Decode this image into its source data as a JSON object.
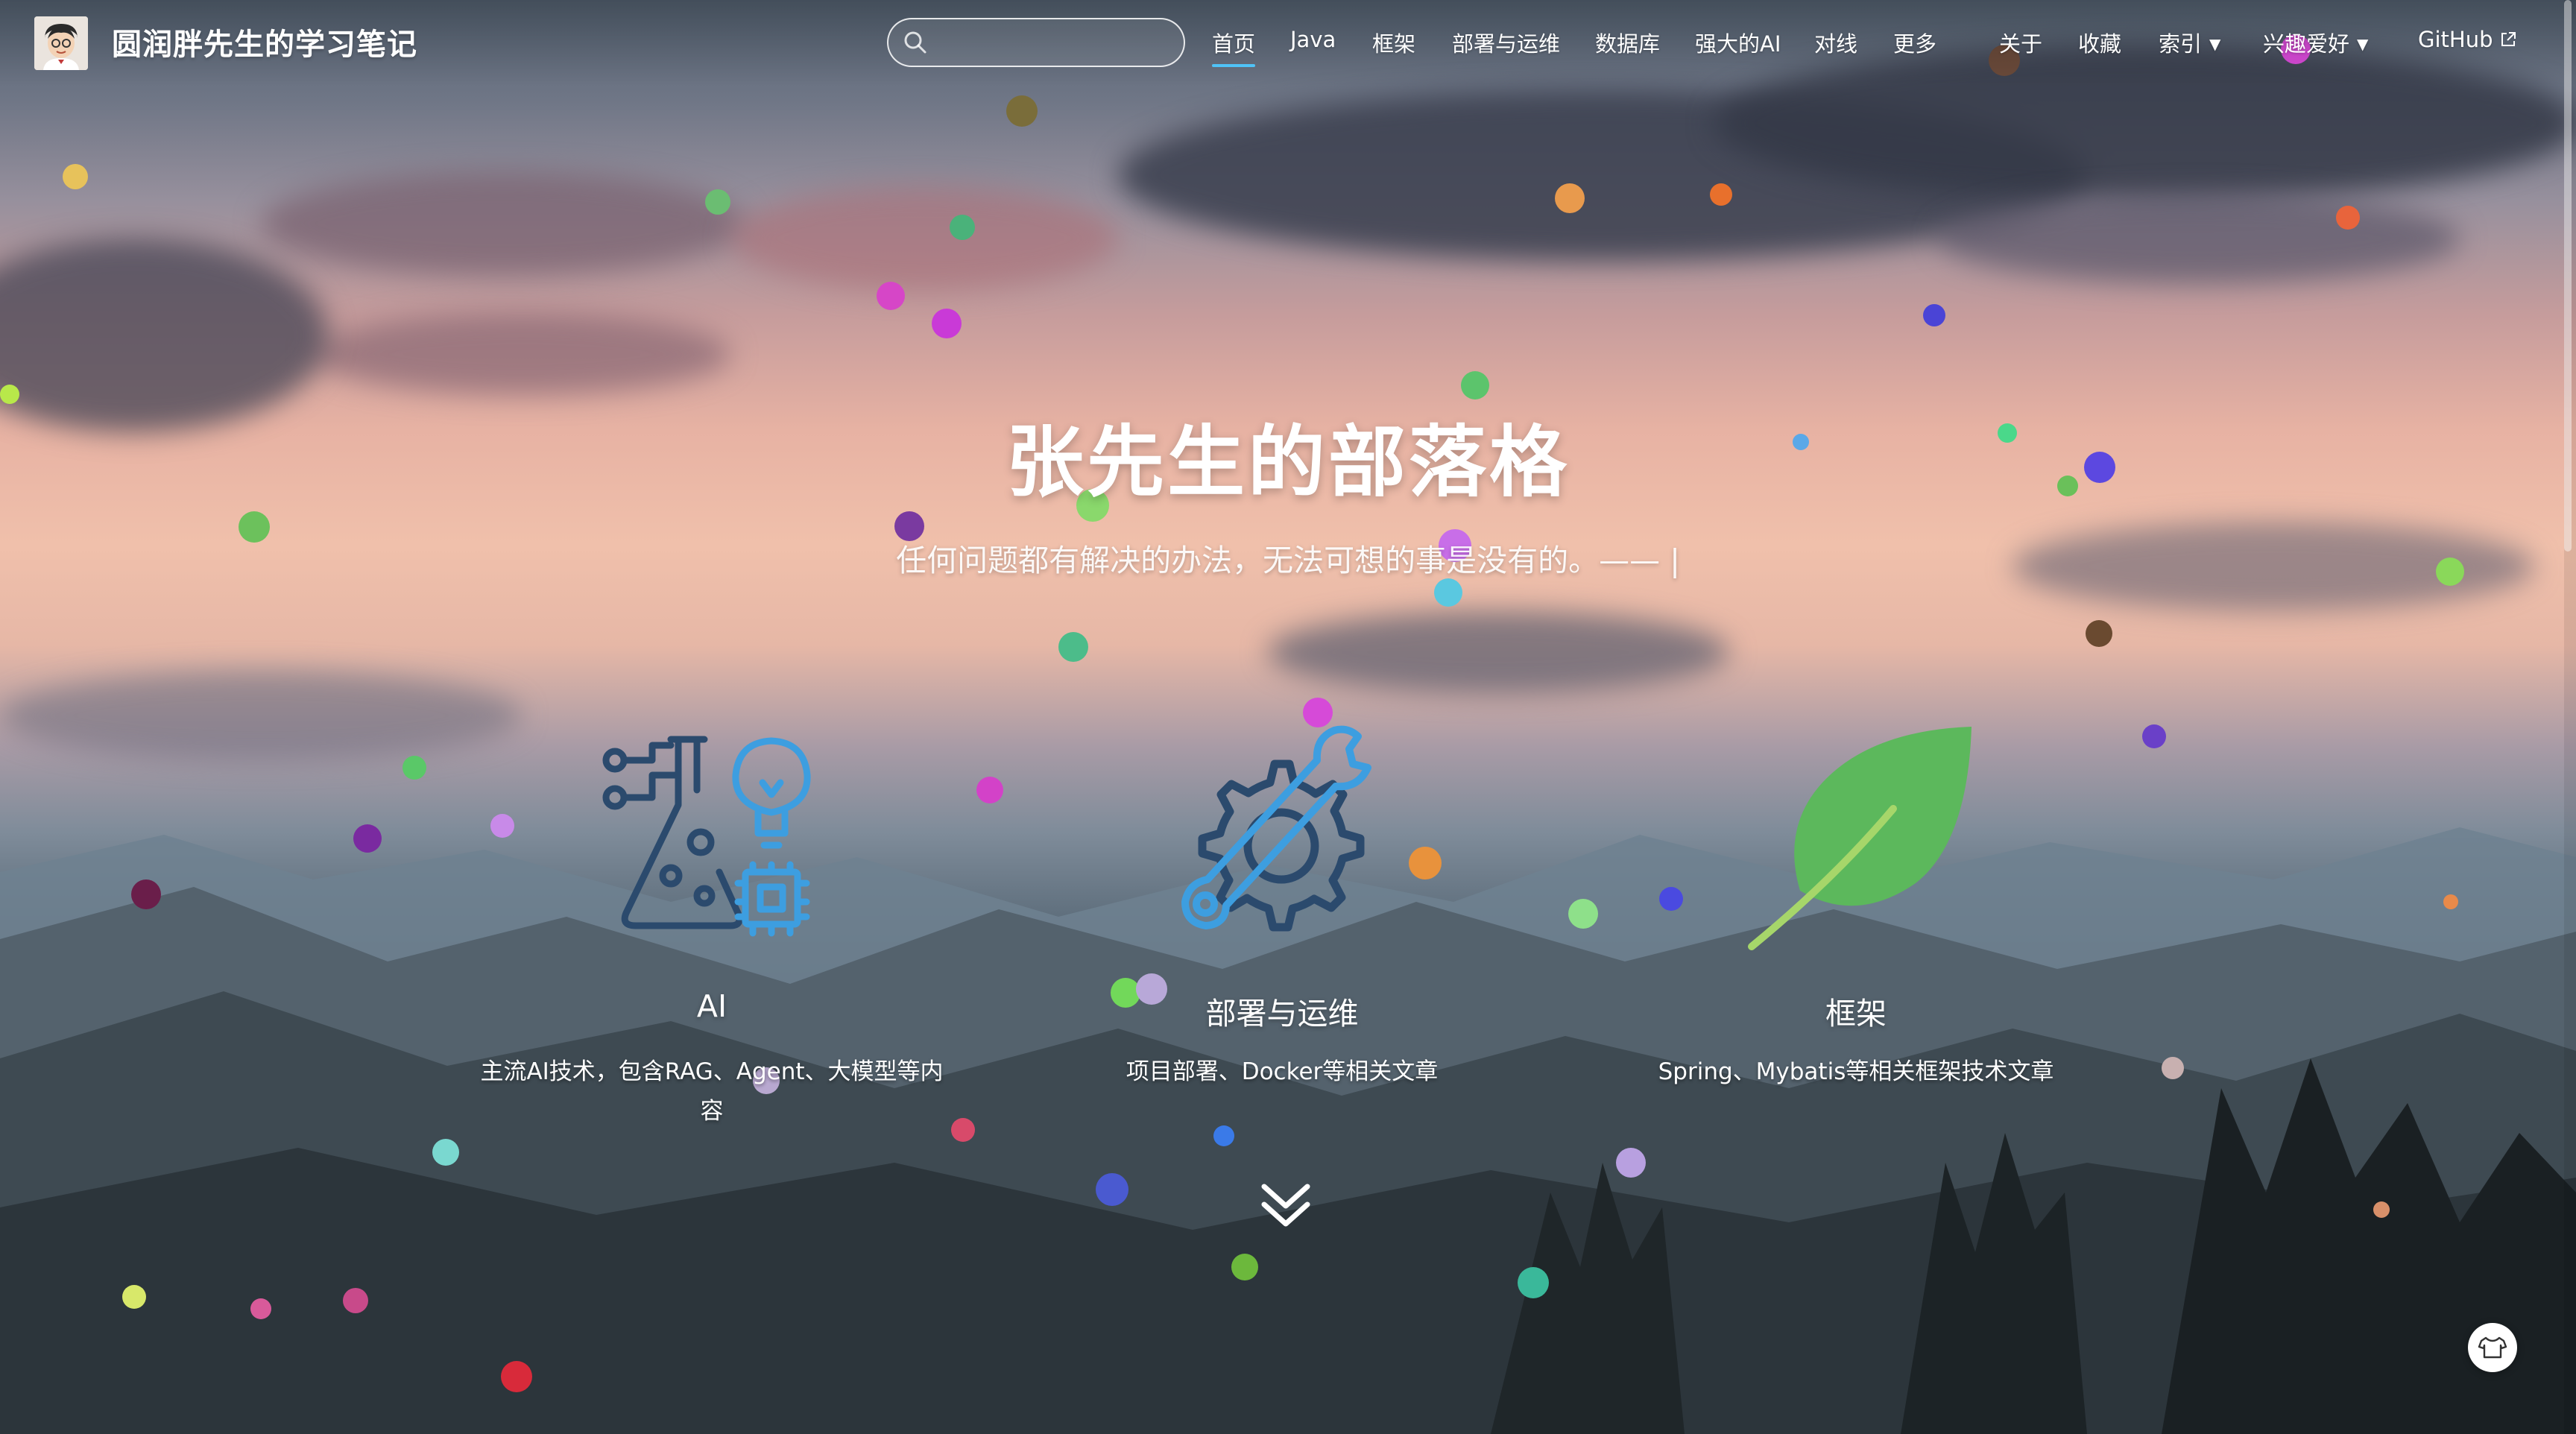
{
  "navbar": {
    "site_title": "圆润胖先生的学习笔记",
    "search_placeholder": "",
    "items": [
      {
        "label": "首页",
        "active": true
      },
      {
        "label": "Java"
      },
      {
        "label": "框架"
      },
      {
        "label": "部署与运维"
      },
      {
        "label": "数据库"
      },
      {
        "label": "强大的AI"
      },
      {
        "label": "对线"
      },
      {
        "label": "更多"
      },
      {
        "label": "关于"
      },
      {
        "label": "收藏"
      },
      {
        "label": "索引",
        "dropdown": true
      },
      {
        "label": "兴趣爱好",
        "dropdown": true
      },
      {
        "label": "GitHub",
        "external": true
      }
    ]
  },
  "hero": {
    "title": "张先生的部落格",
    "subtitle": "任何问题都有解决的办法，无法可想的事是没有的。—— |"
  },
  "features": [
    {
      "icon": "ai-lab-icon",
      "title": "AI",
      "description": "主流AI技术，包含RAG、Agent、大模型等内容"
    },
    {
      "icon": "gear-wrench-icon",
      "title": "部署与运维",
      "description": "项目部署、Docker等相关文章"
    },
    {
      "icon": "leaf-icon",
      "title": "框架",
      "description": "Spring、Mybatis等相关框架技术文章"
    }
  ],
  "colors": {
    "accent": "#4fc3f7",
    "icon_navy": "#2b4a6d",
    "icon_blue": "#3d9ee0",
    "leaf_green": "#5cb85c"
  }
}
